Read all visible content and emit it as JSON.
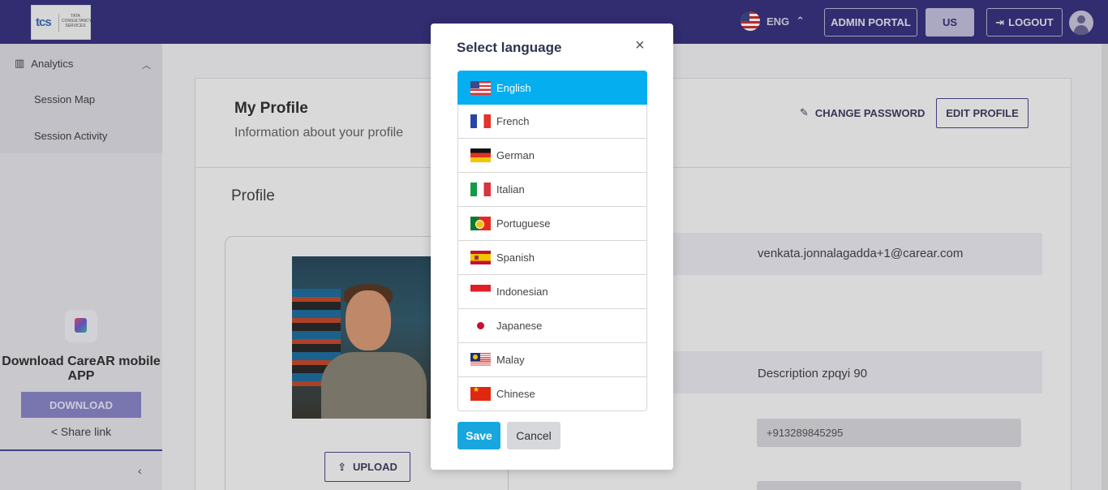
{
  "header": {
    "logo_text": "tcs",
    "logo_subtext": "TATA CONSULTANCY SERVICES",
    "language_code": "ENG",
    "admin_portal_label": "ADMIN PORTAL",
    "us_label": "US",
    "logout_label": "LOGOUT"
  },
  "sidebar": {
    "group_label": "Analytics",
    "items": [
      {
        "label": "Session Map"
      },
      {
        "label": "Session Activity"
      }
    ],
    "app_title": "Download CareAR mobile APP",
    "download_label": "DOWNLOAD",
    "share_label": "Share link"
  },
  "main": {
    "title": "My Profile",
    "subtitle": "Information about your profile",
    "change_password_label": "CHANGE PASSWORD",
    "edit_profile_label": "EDIT PROFILE",
    "section_title": "Profile",
    "upload_label": "UPLOAD",
    "email_value": "venkata.jonnalagadda+1@carear.com",
    "description_value": "Description zpqyi 90",
    "phone_value": "+913289845295",
    "colon": ":"
  },
  "modal": {
    "title": "Select language",
    "close_symbol": "×",
    "languages": [
      {
        "label": "English",
        "flag": "us-flag-icon"
      },
      {
        "label": "French",
        "flag": "fr-flag-icon"
      },
      {
        "label": "German",
        "flag": "de-flag-icon"
      },
      {
        "label": "Italian",
        "flag": "it-flag-icon"
      },
      {
        "label": "Portuguese",
        "flag": "pt-flag-icon"
      },
      {
        "label": "Spanish",
        "flag": "es-flag-icon"
      },
      {
        "label": "Indonesian",
        "flag": "id-flag-icon"
      },
      {
        "label": "Japanese",
        "flag": "jp-flag-icon"
      },
      {
        "label": "Malay",
        "flag": "my-flag-icon"
      },
      {
        "label": "Chinese",
        "flag": "cn-flag-icon"
      }
    ],
    "selected": "English",
    "save_label": "Save",
    "cancel_label": "Cancel"
  },
  "colors": {
    "topbar": "#3a3380",
    "accent_selected": "#05aeef",
    "save_button": "#17a7de"
  }
}
